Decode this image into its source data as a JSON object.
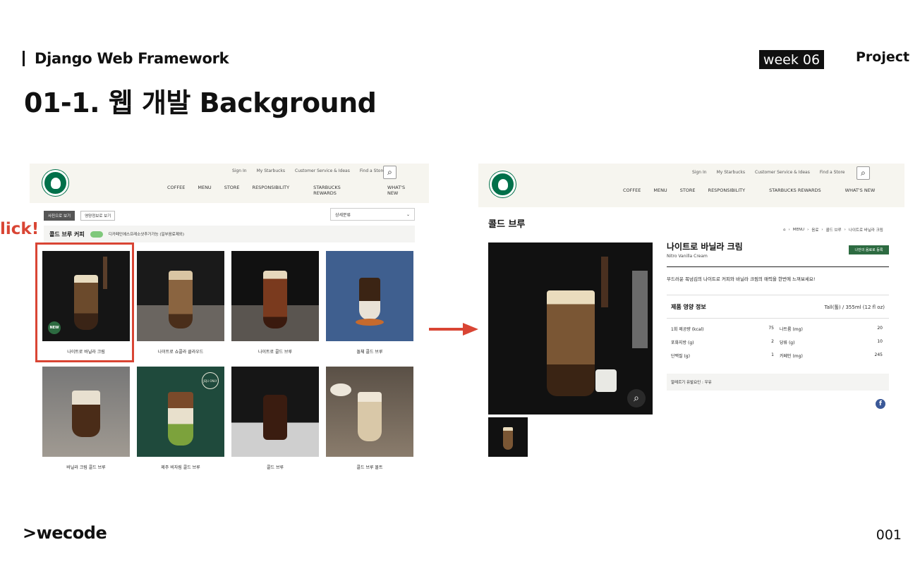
{
  "slide": {
    "course": "Django Web Framework",
    "week": "week 06",
    "section": "Project",
    "title": "01-1. 웹 개발 Background",
    "brand": ">wecode",
    "page": "001"
  },
  "site": {
    "util_links": [
      "Sign In",
      "My Starbucks",
      "Customer Service & Ideas",
      "Find a Store"
    ],
    "gnb": [
      "COFFEE",
      "MENU",
      "STORE",
      "RESPONSIBILITY",
      "STARBUCKS REWARDS",
      "WHAT'S NEW"
    ]
  },
  "list_page": {
    "tab_photo": "사진으로 보기",
    "tab_nutrition": "영양정보로 보기",
    "sort_label": "상세분류",
    "category_name": "콜드 브루 커피",
    "category_note": "디카페인에스프레소샷추가가능 (일부음료제외)",
    "click_label": "lick!",
    "new_badge": "NEW",
    "only_badge": "JEJU ONLY",
    "products": [
      "나이트로 바닐라 크림",
      "나이트로 쇼콜라 클라우드",
      "나이트로 콜드 브루",
      "돌체 콜드 브루",
      "바닐라 크림 콜드 브루",
      "제주 비자림 콜드 브루",
      "콜드 브루",
      "콜드 브루 몰트"
    ]
  },
  "detail_page": {
    "category": "콜드 브루",
    "breadcrumb": [
      "MENU",
      "음료",
      "콜드 브루",
      "나이트로 바닐라 크림"
    ],
    "name": "나이트로 바닐라 크림",
    "name_en": "Nitro Vanilla Cream",
    "fav_button": "나만의 음료로 등록",
    "description": "부드러운 목넘김의 나이트로 커피와 바닐라 크림의 매력을 한번에 느껴보세요!",
    "nutrition_title": "제품 영양 정보",
    "size": "Tall(톨) / 355ml (12 fl oz)",
    "nutrition": [
      {
        "k1": "1회 제공량 (kcal)",
        "v1": "75",
        "k2": "나트륨 (mg)",
        "v2": "20"
      },
      {
        "k1": "포화지방 (g)",
        "v1": "2",
        "k2": "당류 (g)",
        "v2": "10"
      },
      {
        "k1": "단백질 (g)",
        "v1": "1",
        "k2": "카페인 (mg)",
        "v2": "245"
      }
    ],
    "allergy": "알레르기 유발요인 : 우유",
    "fb_glyph": "f"
  }
}
